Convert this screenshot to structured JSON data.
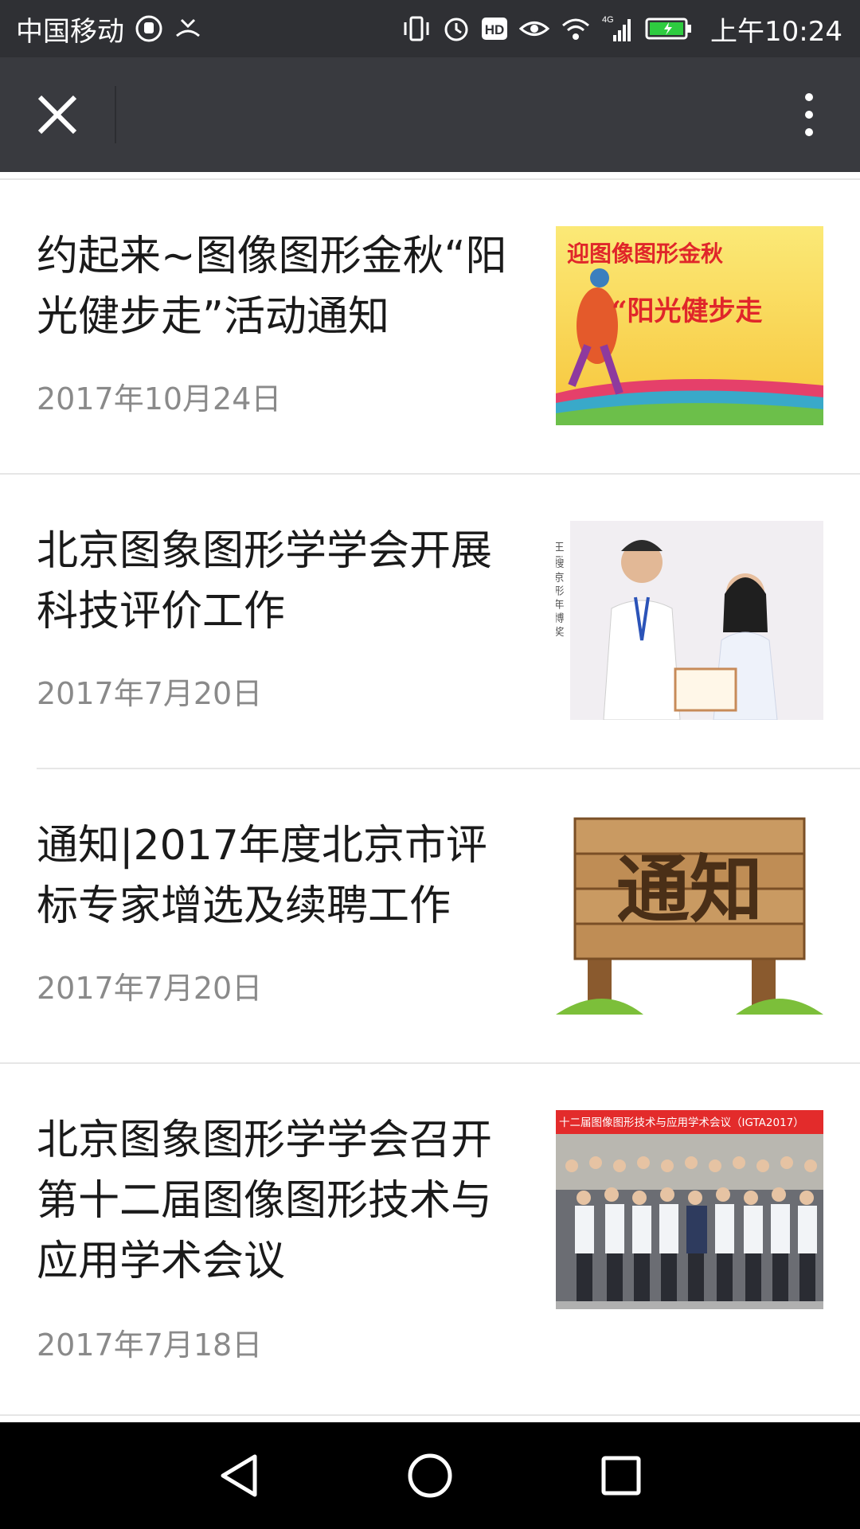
{
  "status_bar": {
    "carrier": "中国移动",
    "network": "4G",
    "time": "上午10:24"
  },
  "articles": [
    {
      "title": "约起来~图像图形金秋“阳光健步走”活动通知",
      "date": "2017年10月24日",
      "thumb_text_1": "迎图像图形金秋",
      "thumb_text_2": "“阳光健步走"
    },
    {
      "title": "北京图象图形学学会开展科技评价工作",
      "date": "2017年7月20日",
      "thumb_side_text": "王 i搜 京 形 年 博 奖"
    },
    {
      "title": "通知|2017年度北京市评标专家增选及续聘工作",
      "date": "2017年7月20日",
      "thumb_text": "通知"
    },
    {
      "title": "北京图象图形学学会召开第十二届图像图形技术与应用学术会议",
      "date": "2017年7月18日",
      "thumb_banner": "十二届图像图形技术与应用学术会议（IGTA2017）"
    }
  ],
  "colors": {
    "status_bg": "#2f3034",
    "title_bg": "#393a3f",
    "title_text": "#1a1a1a",
    "date_text": "#8a8a8a",
    "divider": "#e6e6e6",
    "nav_bg": "#000000"
  }
}
